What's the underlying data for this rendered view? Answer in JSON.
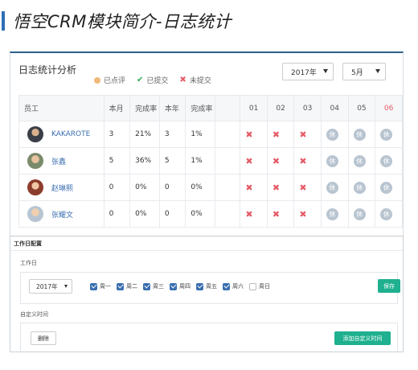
{
  "page": {
    "title": "悟空CRM模块简介-日志统计"
  },
  "stats": {
    "title": "日志统计分析",
    "legend": {
      "pending": "已点评",
      "submitted": "已提交",
      "not_submitted": "未提交"
    },
    "year_select": "2017年",
    "month_select": "5月",
    "headers": [
      "员工",
      "本月",
      "完成率",
      "本年",
      "完成率",
      "",
      "01",
      "02",
      "03",
      "04",
      "05",
      "06"
    ],
    "rest_label": "休",
    "rows": [
      {
        "name": "KAKAROTE",
        "month": "3",
        "month_rate": "21%",
        "year": "3",
        "year_rate": "1%"
      },
      {
        "name": "张鑫",
        "month": "5",
        "month_rate": "36%",
        "year": "5",
        "year_rate": "1%"
      },
      {
        "name": "赵琳熙",
        "month": "0",
        "month_rate": "0%",
        "year": "0",
        "year_rate": "0%"
      },
      {
        "name": "张耀文",
        "month": "0",
        "month_rate": "0%",
        "year": "0",
        "year_rate": "0%"
      }
    ],
    "colors": {
      "link": "#3a6fb0",
      "cross": "#e45b66",
      "check": "#32a852",
      "pending": "#f0b97a",
      "rest": "#b8c4d0"
    }
  },
  "config": {
    "title": "工作日配置",
    "workday_label": "工作日",
    "year_select": "2017年",
    "weekdays": [
      {
        "label": "周一",
        "checked": true
      },
      {
        "label": "周二",
        "checked": true
      },
      {
        "label": "周三",
        "checked": true
      },
      {
        "label": "周四",
        "checked": true
      },
      {
        "label": "周五",
        "checked": true
      },
      {
        "label": "周六",
        "checked": true
      },
      {
        "label": "周日",
        "checked": false
      }
    ],
    "save_label": "保存",
    "custom_label": "自定义时间",
    "delete_label": "删除",
    "add_label": "添加自定义时间",
    "accent": "#1fb08f"
  }
}
